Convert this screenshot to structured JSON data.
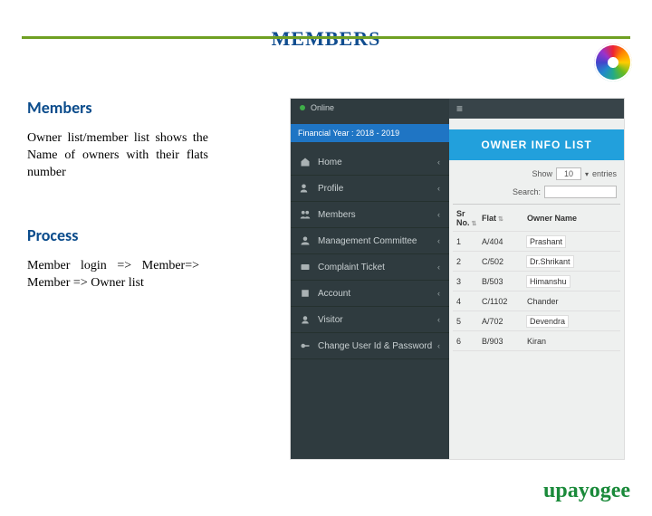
{
  "page": {
    "title": "MEMBERS",
    "brand": "upayogee"
  },
  "left": {
    "h_members": "Members",
    "p_members": "Owner list/member list shows the Name of owners with their flats number",
    "h_process": "Process",
    "p_process": "Member login => Member=> Member => Owner list"
  },
  "shot": {
    "online_label": "Online",
    "fy_label": "Financial Year : 2018 - 2019",
    "sidebar": [
      {
        "label": "Home"
      },
      {
        "label": "Profile"
      },
      {
        "label": "Members"
      },
      {
        "label": "Management Committee"
      },
      {
        "label": "Complaint Ticket"
      },
      {
        "label": "Account"
      },
      {
        "label": "Visitor"
      },
      {
        "label": "Change User Id & Password"
      }
    ],
    "hamburger": "≡",
    "banner": "OWNER INFO LIST",
    "controls": {
      "show_label": "Show",
      "show_value": "10",
      "entries_label": "entries",
      "search_label": "Search:",
      "search_placeholder": ""
    },
    "columns": {
      "sr": "Sr No.",
      "flat": "Flat",
      "owner": "Owner Name"
    },
    "rows": [
      {
        "sr": "1",
        "flat": "A/404",
        "owner": "Prashant"
      },
      {
        "sr": "2",
        "flat": "C/502",
        "owner": "Dr.Shrikant"
      },
      {
        "sr": "3",
        "flat": "B/503",
        "owner": "Himanshu"
      },
      {
        "sr": "4",
        "flat": "C/1102",
        "owner": "Chander"
      },
      {
        "sr": "5",
        "flat": "A/702",
        "owner": "Devendra"
      },
      {
        "sr": "6",
        "flat": "B/903",
        "owner": "Kiran"
      }
    ]
  }
}
